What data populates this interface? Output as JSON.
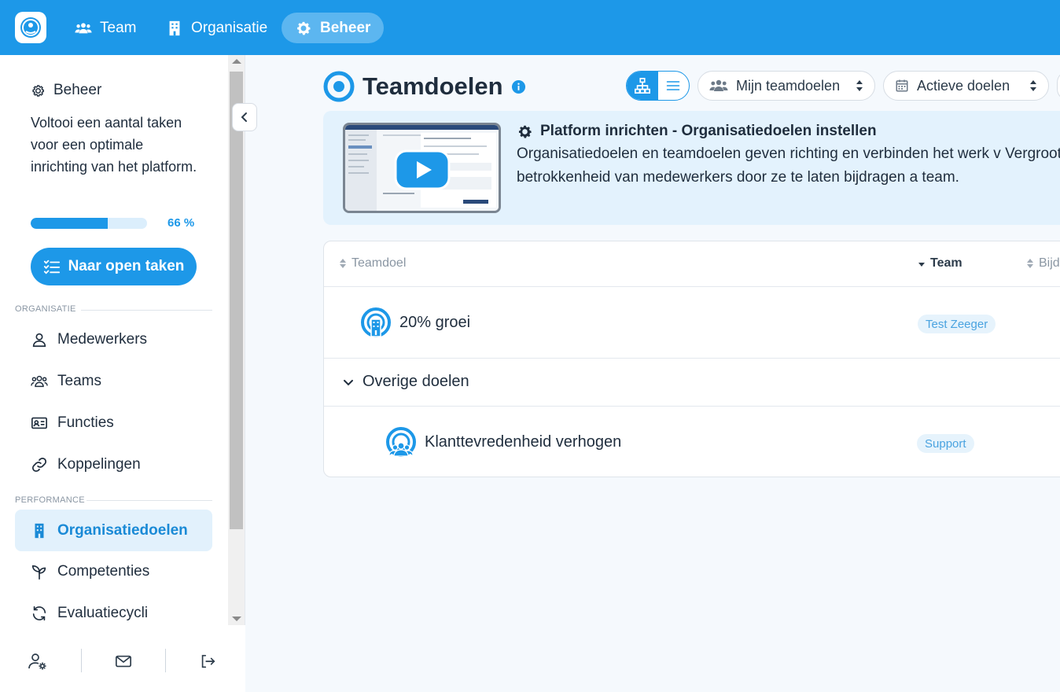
{
  "nav": {
    "items": [
      {
        "label": "Team",
        "icon": "users-icon"
      },
      {
        "label": "Organisatie",
        "icon": "building-icon"
      },
      {
        "label": "Beheer",
        "icon": "gear-icon",
        "active": true
      }
    ]
  },
  "sidebar": {
    "beheer_title": "Beheer",
    "beheer_text": "Voltooi een aantal taken voor een optimale inrichting van het platform.",
    "progress_value": 66,
    "progress_label": "66 %",
    "open_tasks_label": "Naar open taken",
    "sections": [
      {
        "label": "ORGANISATIE",
        "items": [
          {
            "label": "Medewerkers",
            "icon": "user-icon"
          },
          {
            "label": "Teams",
            "icon": "users-icon"
          },
          {
            "label": "Functies",
            "icon": "id-card-icon"
          },
          {
            "label": "Koppelingen",
            "icon": "link-icon"
          }
        ]
      },
      {
        "label": "PERFORMANCE",
        "items": [
          {
            "label": "Organisatiedoelen",
            "icon": "building-icon",
            "active": true
          },
          {
            "label": "Competenties",
            "icon": "sprout-icon"
          },
          {
            "label": "Evaluatiecycli",
            "icon": "refresh-icon"
          }
        ]
      }
    ]
  },
  "main": {
    "title": "Teamdoelen",
    "filters": {
      "scope": "Mijn teamdoelen",
      "status": "Actieve doelen"
    },
    "banner": {
      "title": "Platform inrichten - Organisatiedoelen instellen",
      "text": "Organisatiedoelen en teamdoelen geven richting en verbinden het werk v Vergroot de betrokkenheid van medewerkers door ze te laten bijdragen a team."
    },
    "table": {
      "headers": {
        "goal": "Teamdoel",
        "team": "Team",
        "contribution": "Bijdr"
      },
      "rows": [
        {
          "goal": "20% groei",
          "team": "Test Zeeger"
        }
      ],
      "group_label": "Overige doelen",
      "group_rows": [
        {
          "goal": "Klanttevredenheid verhogen",
          "team": "Support"
        }
      ]
    }
  },
  "colors": {
    "primary": "#1d98e8",
    "active_bg": "#e2f1fc"
  }
}
